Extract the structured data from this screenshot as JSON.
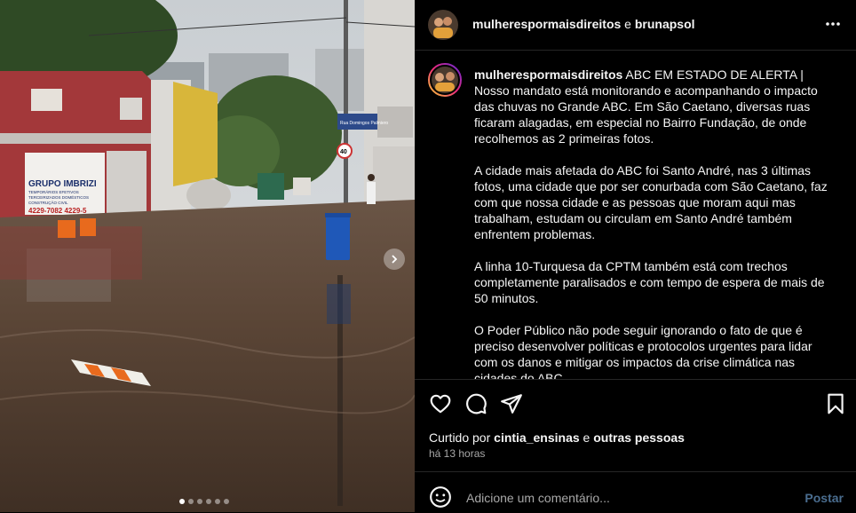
{
  "photo": {
    "sign_title": "GRUPO IMBRIZI",
    "sign_line1": "TEMPORÁRIOS EFETIVOS",
    "sign_line2": "TERCEIRIZADOS DOMÉSTICOS",
    "sign_line3": "CONSTRUÇÃO CIVIL",
    "sign_phone": "4229-7082 4229-5",
    "speed_sign": "40",
    "street_sign": "Rua Domingos Palmiero",
    "carousel_count": 6,
    "carousel_active_index": 0
  },
  "header": {
    "author": "mulherespormaisdireitos",
    "connector": " e ",
    "coauthor": "brunapsol"
  },
  "caption": {
    "username": "mulherespormaisdireitos",
    "p1": " ABC EM ESTADO DE ALERTA | Nosso mandato está monitorando e acompanhando o impacto das chuvas no Grande ABC. Em São Caetano, diversas ruas ficaram alagadas, em especial no Bairro Fundação, de onde recolhemos as 2 primeiras fotos.",
    "p2": "A cidade mais afetada do ABC foi Santo André, nas 3 últimas fotos, uma cidade que por ser conurbada com São Caetano, faz com que nossa cidade e as pessoas que moram aqui mas trabalham, estudam ou circulam em Santo André também enfrentem problemas.",
    "p3": "A linha 10-Turquesa da CPTM também está com trechos completamente paralisados e com tempo de espera de mais de 50 minutos.",
    "p4": "O Poder Público não pode seguir ignorando o fato de que é preciso desenvolver políticas e protocolos urgentes para lidar com os danos e mitigar os impactos da crise climática nas cidades do ABC."
  },
  "likes": {
    "prefix": "Curtido por ",
    "user": "cintia_ensinas",
    "middle": " e ",
    "others": "outras pessoas"
  },
  "time_ago": "há 13 horas",
  "comment": {
    "placeholder": "Adicione um comentário...",
    "post_label": "Postar"
  },
  "colors": {
    "background": "#000000",
    "divider": "#262626",
    "secondary_text": "#a8a8a8",
    "post_button_disabled": "#4a6d8f"
  }
}
